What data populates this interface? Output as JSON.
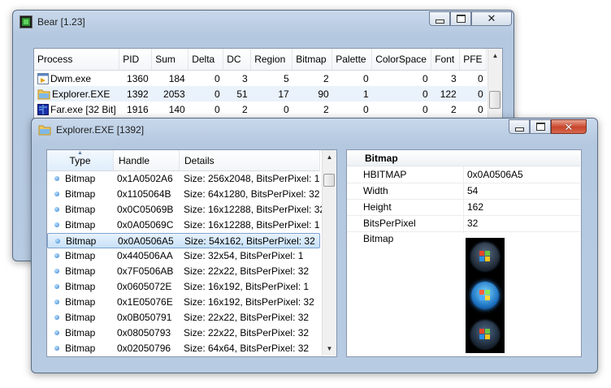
{
  "bear": {
    "title": "Bear [1.23]",
    "columns": [
      "Process",
      "PID",
      "Sum",
      "Delta",
      "DC",
      "Region",
      "Bitmap",
      "Palette",
      "ColorSpace",
      "Font",
      "PFE"
    ],
    "rows": [
      {
        "name": "Dwm.exe",
        "icon": "dwm-app-icon",
        "pid": "1360",
        "sum": "184",
        "delta": "0",
        "dc": "3",
        "region": "5",
        "bitmap": "2",
        "palette": "0",
        "colorspace": "0",
        "font": "3",
        "pfe": "0"
      },
      {
        "name": "Explorer.EXE",
        "icon": "folder-icon",
        "pid": "1392",
        "sum": "2053",
        "delta": "0",
        "dc": "51",
        "region": "17",
        "bitmap": "90",
        "palette": "1",
        "colorspace": "0",
        "font": "122",
        "pfe": "0"
      },
      {
        "name": "Far.exe [32 Bit]",
        "icon": "far-manager-icon",
        "pid": "1916",
        "sum": "140",
        "delta": "0",
        "dc": "2",
        "region": "0",
        "bitmap": "2",
        "palette": "0",
        "colorspace": "0",
        "font": "2",
        "pfe": "0"
      }
    ]
  },
  "explorer": {
    "title": "Explorer.EXE [1392]",
    "columns": {
      "type": "Type",
      "handle": "Handle",
      "details": "Details"
    },
    "rows": [
      {
        "type": "Bitmap",
        "handle": "0x1A0502A6",
        "details": "Size: 256x2048, BitsPerPixel: 1"
      },
      {
        "type": "Bitmap",
        "handle": "0x1105064B",
        "details": "Size: 64x1280, BitsPerPixel: 32"
      },
      {
        "type": "Bitmap",
        "handle": "0x0C05069B",
        "details": "Size: 16x12288, BitsPerPixel: 32"
      },
      {
        "type": "Bitmap",
        "handle": "0x0A05069C",
        "details": "Size: 16x12288, BitsPerPixel: 1"
      },
      {
        "type": "Bitmap",
        "handle": "0x0A0506A5",
        "details": "Size: 54x162, BitsPerPixel: 32",
        "selected": true
      },
      {
        "type": "Bitmap",
        "handle": "0x440506AA",
        "details": "Size: 32x54, BitsPerPixel: 1"
      },
      {
        "type": "Bitmap",
        "handle": "0x7F0506AB",
        "details": "Size: 22x22, BitsPerPixel: 32"
      },
      {
        "type": "Bitmap",
        "handle": "0x0605072E",
        "details": "Size: 16x192, BitsPerPixel: 1"
      },
      {
        "type": "Bitmap",
        "handle": "0x1E05076E",
        "details": "Size: 16x192, BitsPerPixel: 32"
      },
      {
        "type": "Bitmap",
        "handle": "0x0B050791",
        "details": "Size: 22x22, BitsPerPixel: 32"
      },
      {
        "type": "Bitmap",
        "handle": "0x08050793",
        "details": "Size: 22x22, BitsPerPixel: 32"
      },
      {
        "type": "Bitmap",
        "handle": "0x02050796",
        "details": "Size: 64x64, BitsPerPixel: 32"
      }
    ],
    "props": {
      "header": "Bitmap",
      "rows": [
        {
          "key": "HBITMAP",
          "value": "0x0A0506A5"
        },
        {
          "key": "Width",
          "value": "54"
        },
        {
          "key": "Height",
          "value": "162"
        },
        {
          "key": "BitsPerPixel",
          "value": "32"
        }
      ],
      "bitmap_label": "Bitmap"
    }
  },
  "colors": {
    "accent_selection": "#c7e0f8",
    "selection_border": "#7da2ce",
    "close_button": "#c8452a"
  }
}
